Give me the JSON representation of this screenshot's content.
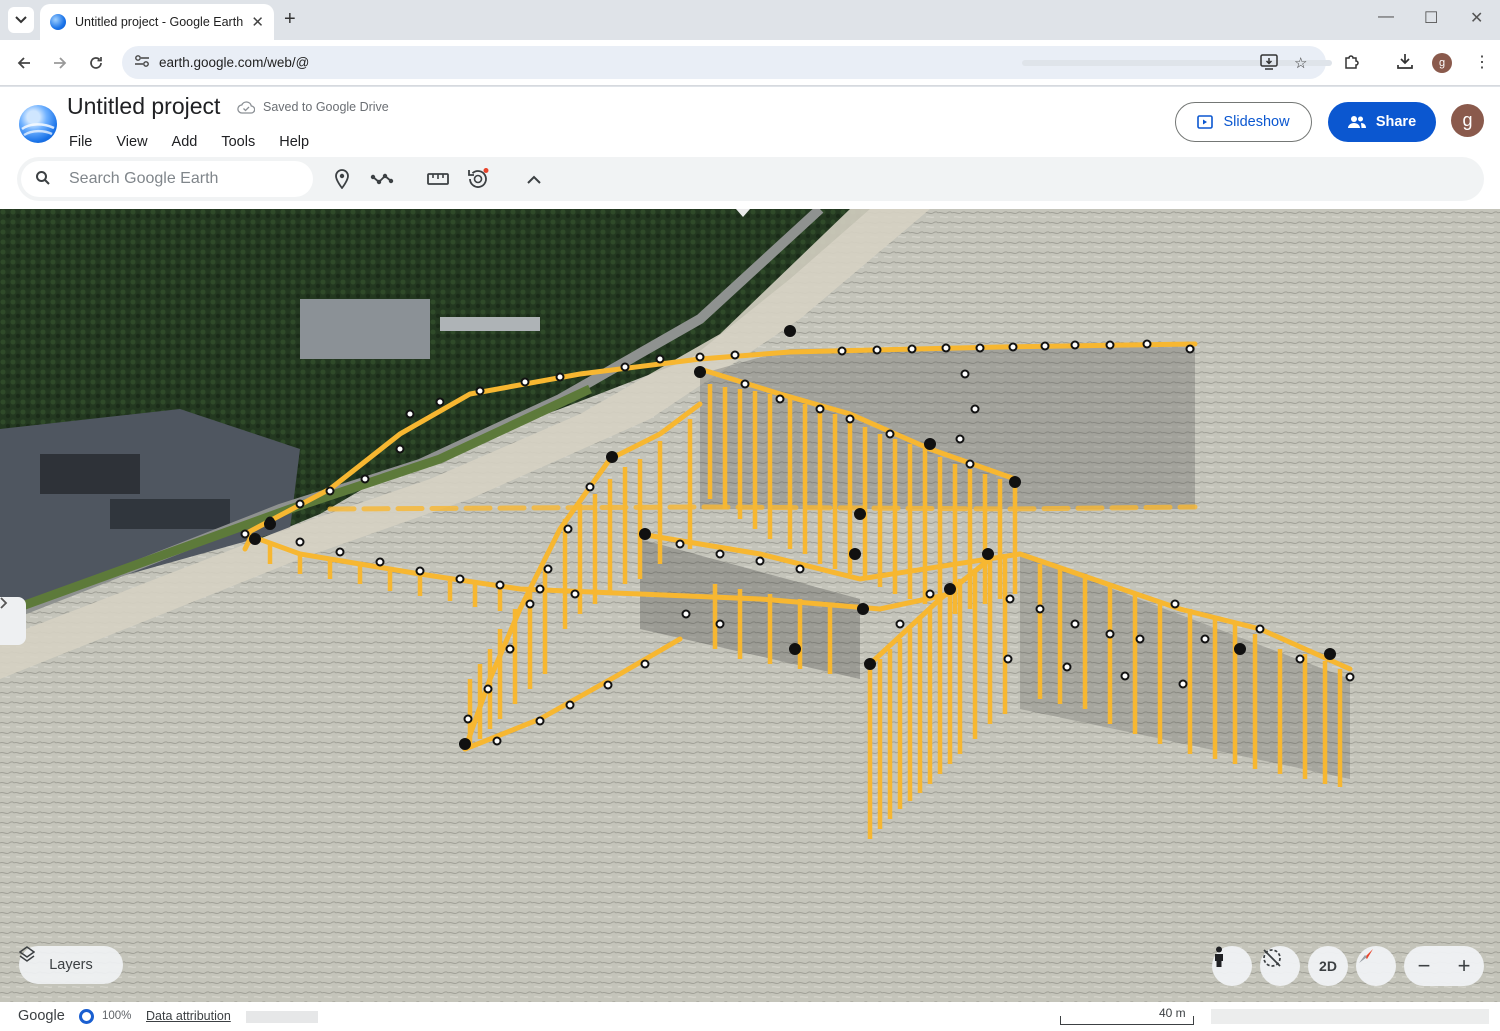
{
  "browser": {
    "tab_title": "Untitled project - Google Earth",
    "url": "earth.google.com/web/@",
    "new_tab": "+",
    "minimize": "—",
    "maximize": "☐",
    "close": "✕",
    "profile_initial": "g"
  },
  "earth": {
    "project_title": "Untitled project",
    "saved_status": "Saved to Google Drive",
    "menu": [
      "File",
      "View",
      "Add",
      "Tools",
      "Help"
    ],
    "slideshow_label": "Slideshow",
    "share_label": "Share",
    "avatar_initial": "g",
    "search_placeholder": "Search Google Earth"
  },
  "map": {
    "layers_label": "Layers",
    "view_mode_label": "2D",
    "zoom_out": "−",
    "zoom_in": "+"
  },
  "footer": {
    "logo": "Google",
    "load_percent": "100%",
    "attribution": "Data attribution",
    "scale_label": "40 m"
  },
  "colors": {
    "accent": "#0b57d0",
    "track_line": "#f7b731",
    "forest": "#22341f",
    "sand": "#d8d3c3"
  }
}
